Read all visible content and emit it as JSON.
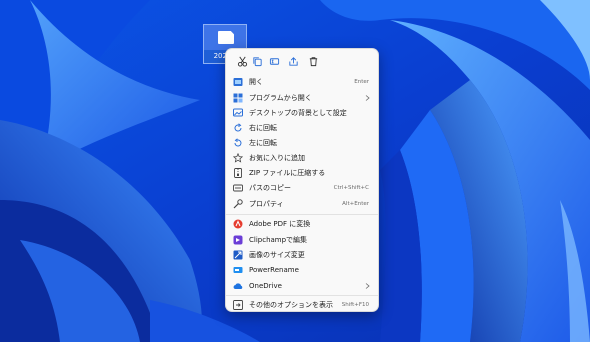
{
  "desktop": {
    "file_icon_label": "2022-0"
  },
  "toolbar": {
    "buttons": [
      {
        "icon": "cut-icon"
      },
      {
        "icon": "copy-icon"
      },
      {
        "icon": "rename-icon"
      },
      {
        "icon": "share-icon"
      },
      {
        "icon": "delete-icon"
      }
    ]
  },
  "menu": {
    "group1": [
      {
        "label": "開く",
        "shortcut": "Enter",
        "icon": "open-icon"
      },
      {
        "label": "プログラムから開く",
        "shortcut": "",
        "icon": "open-with-icon",
        "submenu": true
      },
      {
        "label": "デスクトップの背景として設定",
        "shortcut": "",
        "icon": "set-wallpaper-icon"
      },
      {
        "label": "右に回転",
        "shortcut": "",
        "icon": "rotate-right-icon"
      },
      {
        "label": "左に回転",
        "shortcut": "",
        "icon": "rotate-left-icon"
      },
      {
        "label": "お気に入りに追加",
        "shortcut": "",
        "icon": "star-icon"
      },
      {
        "label": "ZIP ファイルに圧縮する",
        "shortcut": "",
        "icon": "zip-icon"
      },
      {
        "label": "パスのコピー",
        "shortcut": "Ctrl+Shift+C",
        "icon": "copy-path-icon"
      },
      {
        "label": "プロパティ",
        "shortcut": "Alt+Enter",
        "icon": "wrench-icon"
      }
    ],
    "group2": [
      {
        "label": "Adobe PDF に変換",
        "shortcut": "",
        "icon": "adobe-pdf-icon"
      },
      {
        "label": "Clipchampで編集",
        "shortcut": "",
        "icon": "clipchamp-icon"
      },
      {
        "label": "画像のサイズ変更",
        "shortcut": "",
        "icon": "image-resize-icon"
      },
      {
        "label": "PowerRename",
        "shortcut": "",
        "icon": "powerrename-icon"
      },
      {
        "label": "OneDrive",
        "shortcut": "",
        "icon": "onedrive-icon",
        "submenu": true
      }
    ],
    "group3": [
      {
        "label": "その他のオプションを表示",
        "shortcut": "Shift+F10",
        "icon": "more-options-icon"
      }
    ]
  },
  "colors": {
    "wallpaper_dark": "#0a2fb8",
    "wallpaper_light": "#4f9dff",
    "menu_bg": "#f9f9f9",
    "icon_blue": "#2b6fd8"
  }
}
